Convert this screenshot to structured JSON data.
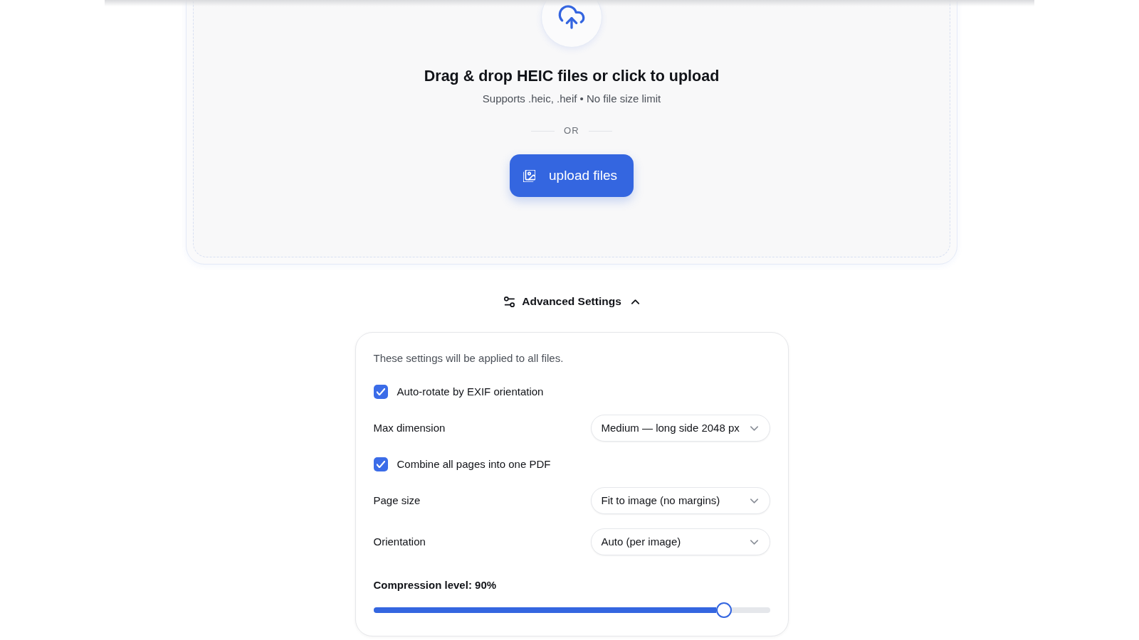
{
  "upload": {
    "heading": "Drag & drop HEIC files or click to upload",
    "subtitle": "Supports .heic, .heif • No file size limit",
    "divider_label": "OR",
    "button": "upload files"
  },
  "advanced_settings": {
    "label": "Advanced Settings",
    "expanded": true
  },
  "settings": {
    "description": "These settings will be applied to all files.",
    "rows": [
      {
        "kind": "checkbox",
        "label": "Auto-rotate by EXIF orientation",
        "checked": true
      },
      {
        "kind": "select",
        "label": "Max dimension",
        "value": "Medium — long side 2048 px"
      },
      {
        "kind": "checkbox",
        "label": "Combine all pages into one PDF",
        "checked": true
      },
      {
        "kind": "select",
        "label": "Page size",
        "value": "Fit to image (no margins)"
      },
      {
        "kind": "select",
        "label": "Orientation",
        "value": "Auto (per image)"
      },
      {
        "kind": "slider",
        "label": "Compression level: 90%",
        "level": 0.9
      }
    ]
  }
}
